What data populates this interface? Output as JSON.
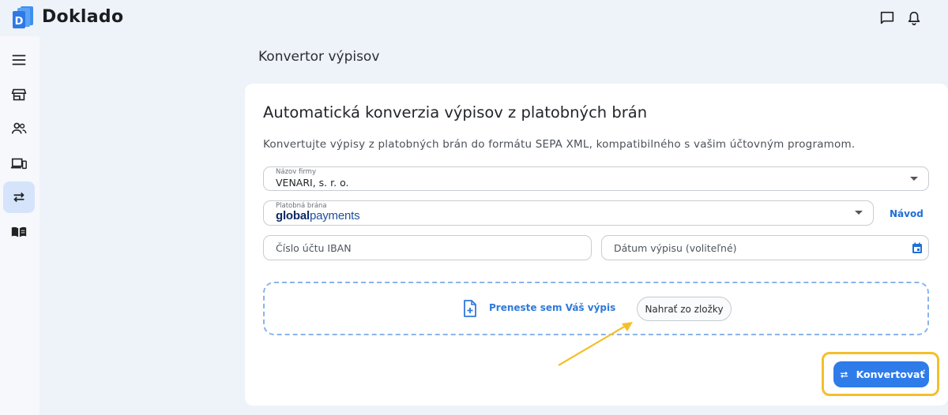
{
  "app": {
    "brand": "Doklado"
  },
  "header": {
    "icons": [
      "chat-icon",
      "bell-icon"
    ]
  },
  "sidebar": {
    "items": [
      {
        "icon": "menu-icon",
        "active": false
      },
      {
        "icon": "store-icon",
        "active": false
      },
      {
        "icon": "people-icon",
        "active": false
      },
      {
        "icon": "devices-icon",
        "active": false
      },
      {
        "icon": "swap-icon",
        "active": true
      },
      {
        "icon": "book-icon",
        "active": false
      }
    ]
  },
  "page": {
    "title": "Konvertor výpisov"
  },
  "card": {
    "title": "Automatická konverzia výpisov z platobných brán",
    "subtitle": "Konvertujte výpisy z platobných brán do formátu SEPA XML, kompatibilného s vašim účtovným programom."
  },
  "form": {
    "company": {
      "label": "Názov firmy",
      "value": "VENARI, s. r. o."
    },
    "gateway": {
      "label": "Platobná brána",
      "logo_bold": "global",
      "logo_light": "payments"
    },
    "guide_link": "Návod",
    "iban": {
      "placeholder": "Číslo účtu IBAN"
    },
    "date": {
      "placeholder": "Dátum výpisu (voliteľné)"
    }
  },
  "upload": {
    "drop_text": "Preneste sem Váš výpis",
    "button_label": "Nahrať zo zložky"
  },
  "actions": {
    "convert_label": "Konvertovať"
  },
  "colors": {
    "accent": "#2e7bea",
    "highlight": "#f4bf2a",
    "active_nav": "#d6e4fb",
    "link": "#1f6fd6"
  }
}
